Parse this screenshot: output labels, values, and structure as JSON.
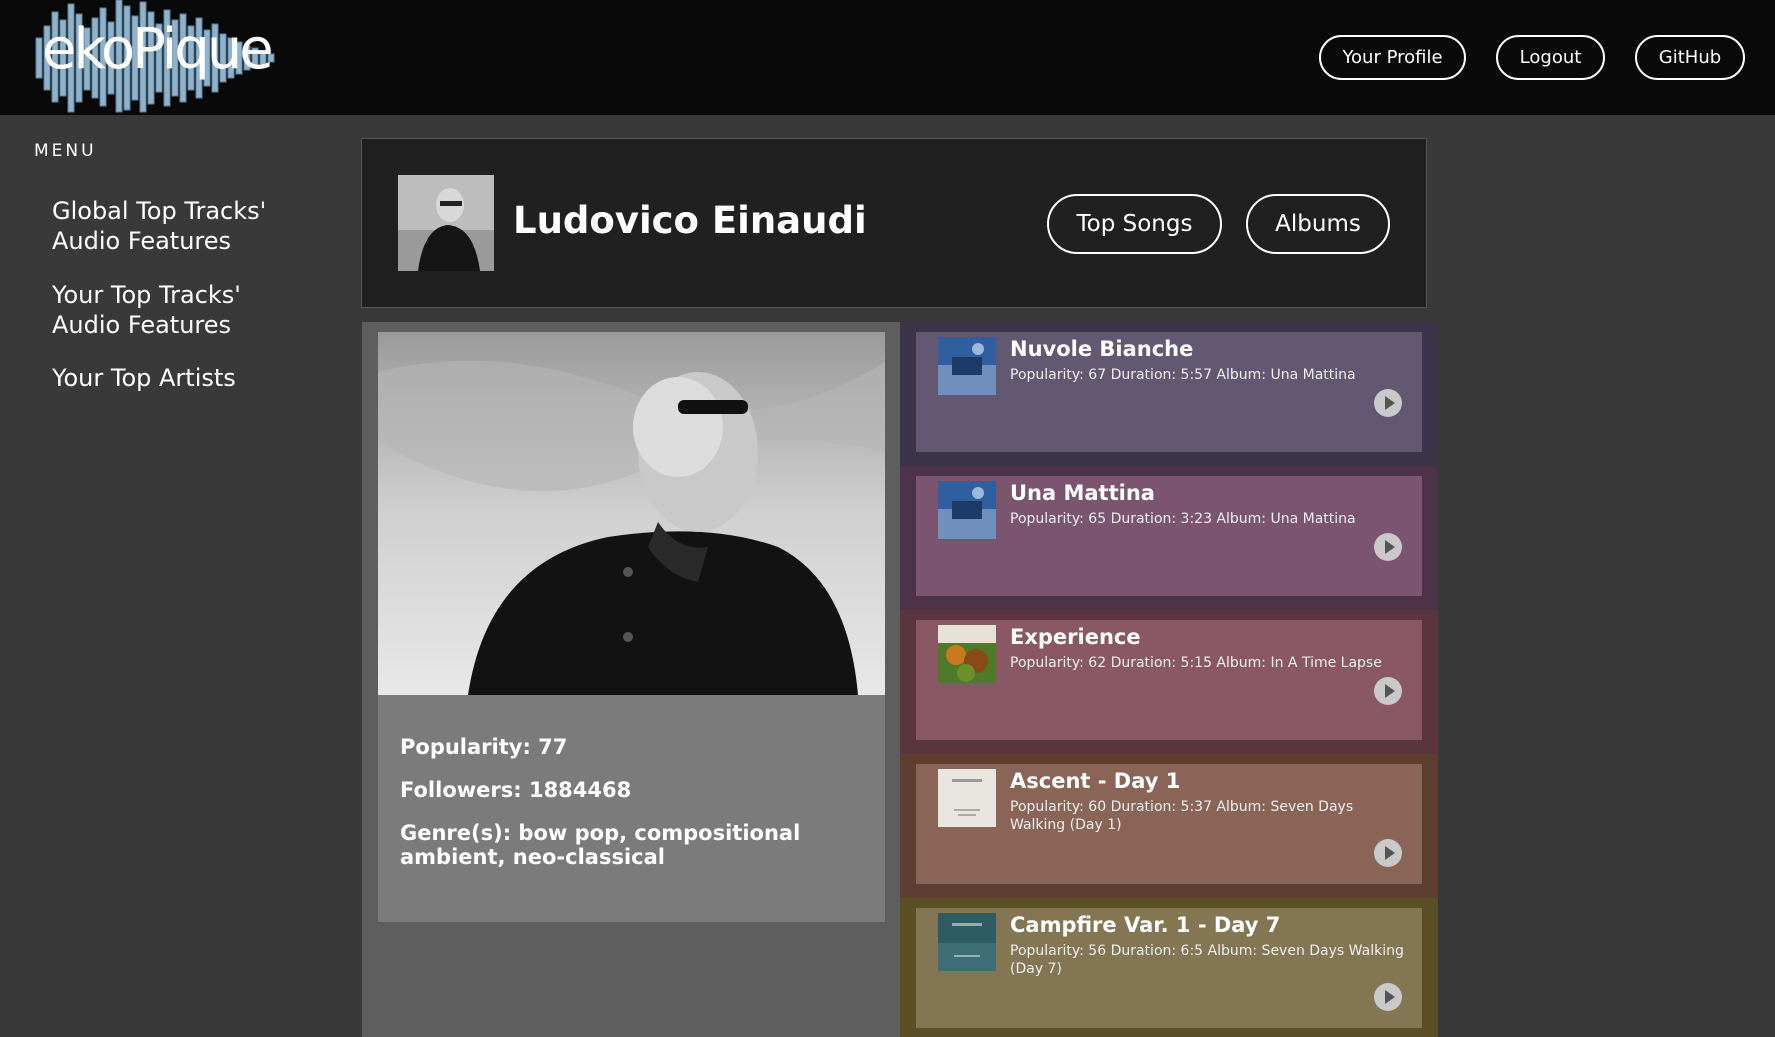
{
  "app": {
    "logo_text": "ekoPique"
  },
  "nav": {
    "profile": "Your Profile",
    "logout": "Logout",
    "github": "GitHub"
  },
  "sidebar": {
    "title": "MENU",
    "items": [
      {
        "label": "Global Top Tracks' Audio Features"
      },
      {
        "label": "Your Top Tracks' Audio Features"
      },
      {
        "label": "Your Top Artists"
      }
    ]
  },
  "artist": {
    "name": "Ludovico Einaudi",
    "popularity": "Popularity: 77",
    "followers": "Followers: 1884468",
    "genres": "Genre(s): bow pop, compositional ambient, neo-classical"
  },
  "tabs": {
    "top_songs": "Top Songs",
    "albums": "Albums"
  },
  "tracks": [
    {
      "title": "Nuvole Bianche",
      "meta": "Popularity: 67 Duration: 5:57 Album: Una Mattina",
      "band": "#3c3449",
      "card": "#625872",
      "cover": "una-mattina-cover"
    },
    {
      "title": "Una Mattina",
      "meta": "Popularity: 65 Duration: 3:23 Album: Una Mattina",
      "band": "#4d3348",
      "card": "#7b5570",
      "cover": "una-mattina-cover"
    },
    {
      "title": "Experience",
      "meta": "Popularity: 62 Duration: 5:15 Album: In A Time Lapse",
      "band": "#5a3540",
      "card": "#8a5864",
      "cover": "in-a-time-lapse-cover"
    },
    {
      "title": "Ascent - Day 1",
      "meta": "Popularity: 60 Duration: 5:37 Album: Seven Days Walking (Day 1)",
      "band": "#5e3e31",
      "card": "#8b6458",
      "cover": "seven-days-walking-1-cover"
    },
    {
      "title": "Campfire Var. 1 - Day 7",
      "meta": "Popularity: 56 Duration: 6:5 Album: Seven Days Walking (Day 7)",
      "band": "#5b4f28",
      "card": "#857653",
      "cover": "seven-days-walking-7-cover"
    }
  ]
}
